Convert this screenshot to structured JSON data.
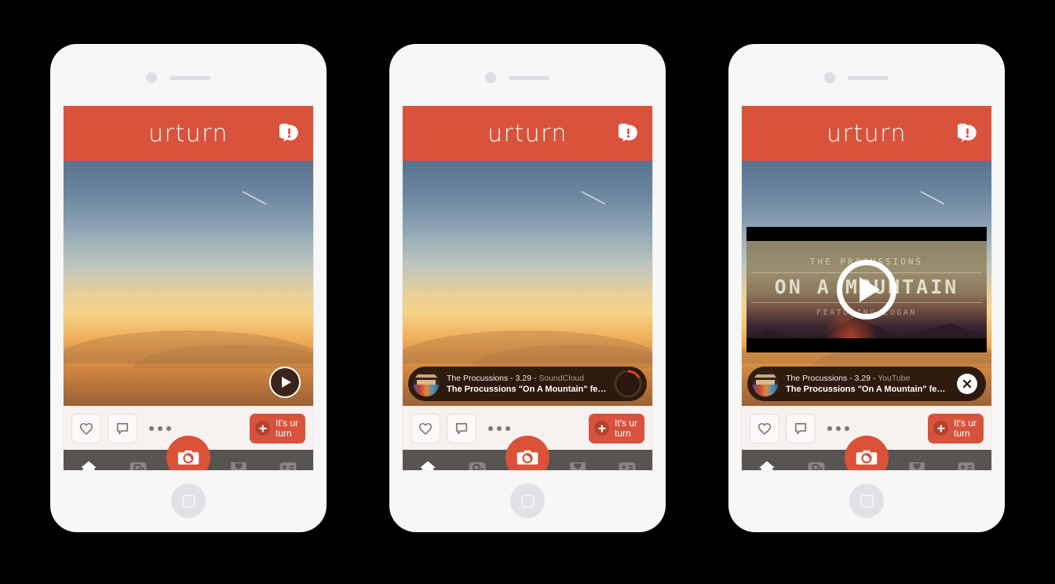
{
  "app": {
    "logo": "urturn",
    "notification_icon": "alert-bubble-icon",
    "accent_color": "#d9533c",
    "nav_bar_color": "#585451"
  },
  "action_bar": {
    "like_icon": "heart-icon",
    "comment_icon": "speech-bubble-icon",
    "more_icon": "ellipsis-icon",
    "ur_turn_label": "It's ur\nturn",
    "plus_icon": "plus-icon"
  },
  "nav": {
    "items": [
      {
        "name": "home",
        "icon": "home-icon",
        "active": true
      },
      {
        "name": "search",
        "icon": "search-icon",
        "active": false
      },
      {
        "name": "camera",
        "icon": "camera-icon",
        "active": false
      },
      {
        "name": "activity",
        "icon": "heart-bubble-icon",
        "active": false
      },
      {
        "name": "profile",
        "icon": "contact-card-icon",
        "active": false
      }
    ]
  },
  "phones": [
    {
      "id": "phone-1",
      "state": "photo-with-play-badge",
      "post": {
        "media_type": "photo",
        "photo_description": "sunset sky over distant hills"
      },
      "play_badge": {
        "icon": "play-icon",
        "visible": true
      },
      "media_bar": {
        "visible": false
      },
      "video_overlay": {
        "visible": false
      }
    },
    {
      "id": "phone-2",
      "state": "audio-playing",
      "post": {
        "media_type": "photo",
        "photo_description": "sunset sky over distant hills"
      },
      "play_badge": {
        "icon": "play-icon",
        "visible": false
      },
      "media_bar": {
        "visible": true,
        "artist_line": "The Procussions - 3.29 - ",
        "source": "SoundCloud",
        "track_title": "The Procussions \"On A Mountain\" feat. Loga…",
        "control_icon": "pause-icon",
        "progress_percent": 18,
        "progress_color": "#e0452c"
      },
      "video_overlay": {
        "visible": false
      }
    },
    {
      "id": "phone-3",
      "state": "video-overlay",
      "post": {
        "media_type": "photo",
        "photo_description": "sunset sky over distant hills"
      },
      "play_badge": {
        "icon": "play-icon",
        "visible": false
      },
      "media_bar": {
        "visible": true,
        "artist_line": "The Procussions - 3.29 - ",
        "source": "YouTube",
        "track_title": "The Procussions \"On A Mountain\" feat. Loga…",
        "control_icon": "close-icon",
        "progress_percent": 0,
        "progress_color": "#e0452c"
      },
      "video_overlay": {
        "visible": true,
        "title_top": "THE PROCUSSIONS",
        "title_main": "ON A MOUNTAIN",
        "title_sub": "FEATURING LOGAN",
        "play_icon": "play-icon"
      }
    }
  ]
}
